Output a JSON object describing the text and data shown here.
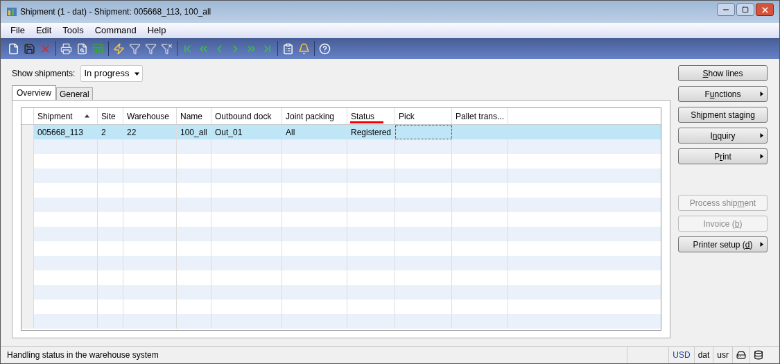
{
  "window": {
    "title": "Shipment (1 - dat) - Shipment: 005668_113, 100_all"
  },
  "menu": [
    "File",
    "Edit",
    "Tools",
    "Command",
    "Help"
  ],
  "filter": {
    "label": "Show shipments:",
    "value": "In progress"
  },
  "tabs": [
    {
      "label": "Overview",
      "selected": true
    },
    {
      "label": "General",
      "selected": false
    }
  ],
  "table": {
    "columns": [
      {
        "label": "Shipment",
        "sorted": true,
        "marked": false
      },
      {
        "label": "Site",
        "sorted": false,
        "marked": false
      },
      {
        "label": "Warehouse",
        "sorted": false,
        "marked": false
      },
      {
        "label": "Name",
        "sorted": false,
        "marked": false
      },
      {
        "label": "Outbound dock",
        "sorted": false,
        "marked": false
      },
      {
        "label": "Joint packing",
        "sorted": false,
        "marked": false
      },
      {
        "label": "Status",
        "sorted": false,
        "marked": true
      },
      {
        "label": "Pick",
        "sorted": false,
        "marked": false
      },
      {
        "label": "Pallet trans...",
        "sorted": false,
        "marked": false
      }
    ],
    "rows": [
      {
        "selected": true,
        "cells": [
          "005668_113",
          "2",
          "22",
          "100_all",
          "Out_01",
          "All",
          "Registered",
          "",
          ""
        ]
      }
    ]
  },
  "buttons": [
    {
      "key": "S",
      "post": "how lines",
      "submenu": false,
      "disabled": false
    },
    {
      "pre": "F",
      "key": "u",
      "post": "nctions",
      "submenu": true,
      "disabled": false
    },
    {
      "pre": "Sh",
      "key": "i",
      "post": "pment staging",
      "submenu": false,
      "disabled": false
    },
    {
      "pre": "I",
      "key": "n",
      "post": "quiry",
      "submenu": true,
      "disabled": false
    },
    {
      "pre": "P",
      "key": "r",
      "post": "int",
      "submenu": true,
      "disabled": false
    }
  ],
  "record_buttons": [
    {
      "pre": "Process ship",
      "key": "m",
      "post": "ent",
      "submenu": false,
      "disabled": true
    },
    {
      "pre": "Invoice (",
      "key": "b",
      "post": ")",
      "submenu": false,
      "disabled": true
    },
    {
      "pre": "Printer setup (",
      "key": "d",
      "post": ")",
      "submenu": true,
      "disabled": false
    }
  ],
  "status_bar": {
    "message": "Handling status in the warehouse system",
    "currency": "USD",
    "company": "dat",
    "user": "usr"
  }
}
